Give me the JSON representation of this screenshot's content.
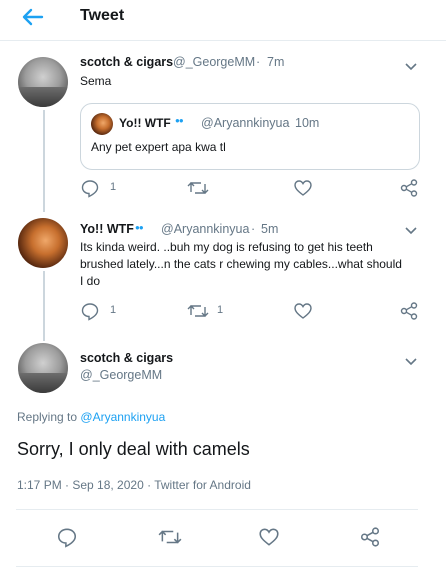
{
  "header": {
    "title": "Tweet"
  },
  "tweets": [
    {
      "name": "scotch & cigars",
      "handle": "@_GeorgeMM",
      "time": "7m",
      "text": "Sema",
      "quote": {
        "name": "Yo!! WTF",
        "emoji": "👀",
        "handle": "@Aryannkinyua",
        "time": "10m",
        "text": "Any pet expert apa kwa tl"
      },
      "actions": {
        "reply_count": "1",
        "retweet_count": "",
        "like_count": ""
      }
    },
    {
      "name": "Yo!! WTF",
      "emoji": "👀",
      "handle": "@Aryannkinyua",
      "time": "5m",
      "text": "Its kinda weird. ..buh my dog is refusing to get his teeth brushed lately...n the cats r chewing my cables...what should I do",
      "actions": {
        "reply_count": "1",
        "retweet_count": "1",
        "like_count": ""
      }
    }
  ],
  "main_tweet": {
    "name": "scotch & cigars",
    "handle": "@_GeorgeMM",
    "replying_prefix": "Replying to",
    "replying_to": "@Aryannkinyua",
    "text": "Sorry, I only deal with camels",
    "timestamp": "1:17 PM · Sep 18, 2020 · Twitter for Android"
  },
  "colors": {
    "accent": "#1da1f2",
    "muted": "#657786",
    "border": "#e6ecf0",
    "thread": "#ccd6dd"
  },
  "icons": [
    "back-arrow-icon",
    "chevron-down-icon",
    "reply-icon",
    "retweet-icon",
    "like-icon",
    "share-icon"
  ]
}
